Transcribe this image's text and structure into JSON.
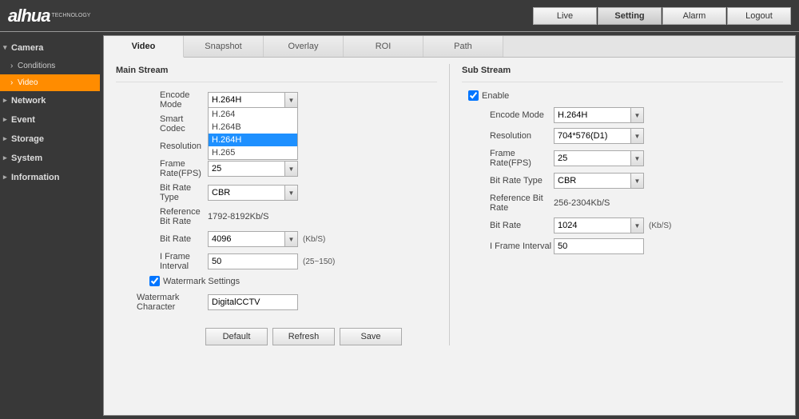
{
  "logo": "alhua",
  "logo_sub": "TECHNOLOGY",
  "header_nav": {
    "live": "Live",
    "setting": "Setting",
    "alarm": "Alarm",
    "logout": "Logout"
  },
  "sidebar": {
    "camera": "Camera",
    "conditions": "Conditions",
    "video": "Video",
    "network": "Network",
    "event": "Event",
    "storage": "Storage",
    "system": "System",
    "information": "Information"
  },
  "tabs": {
    "video": "Video",
    "snapshot": "Snapshot",
    "overlay": "Overlay",
    "roi": "ROI",
    "path": "Path"
  },
  "main_stream": {
    "title": "Main Stream",
    "encode_mode_label": "Encode Mode",
    "encode_mode_value": "H.264H",
    "encode_options": [
      "H.264",
      "H.264B",
      "H.264H",
      "H.265"
    ],
    "smart_codec_label": "Smart Codec",
    "resolution_label": "Resolution",
    "frame_rate_label": "Frame Rate(FPS)",
    "frame_rate_value": "25",
    "bit_rate_type_label": "Bit Rate Type",
    "bit_rate_type_value": "CBR",
    "ref_bit_rate_label": "Reference Bit Rate",
    "ref_bit_rate_value": "1792-8192Kb/S",
    "bit_rate_label": "Bit Rate",
    "bit_rate_value": "4096",
    "bit_rate_unit": "(Kb/S)",
    "iframe_label": "I Frame Interval",
    "iframe_value": "50",
    "iframe_unit": "(25~150)",
    "watermark_label": "Watermark Settings",
    "watermark_char_label": "Watermark Character",
    "watermark_char_value": "DigitalCCTV"
  },
  "sub_stream": {
    "title": "Sub Stream",
    "enable_label": "Enable",
    "encode_mode_label": "Encode Mode",
    "encode_mode_value": "H.264H",
    "resolution_label": "Resolution",
    "resolution_value": "704*576(D1)",
    "frame_rate_label": "Frame Rate(FPS)",
    "frame_rate_value": "25",
    "bit_rate_type_label": "Bit Rate Type",
    "bit_rate_type_value": "CBR",
    "ref_bit_rate_label": "Reference Bit Rate",
    "ref_bit_rate_value": "256-2304Kb/S",
    "bit_rate_label": "Bit Rate",
    "bit_rate_value": "1024",
    "bit_rate_unit": "(Kb/S)",
    "iframe_label": "I Frame Interval",
    "iframe_value": "50"
  },
  "buttons": {
    "default": "Default",
    "refresh": "Refresh",
    "save": "Save"
  }
}
